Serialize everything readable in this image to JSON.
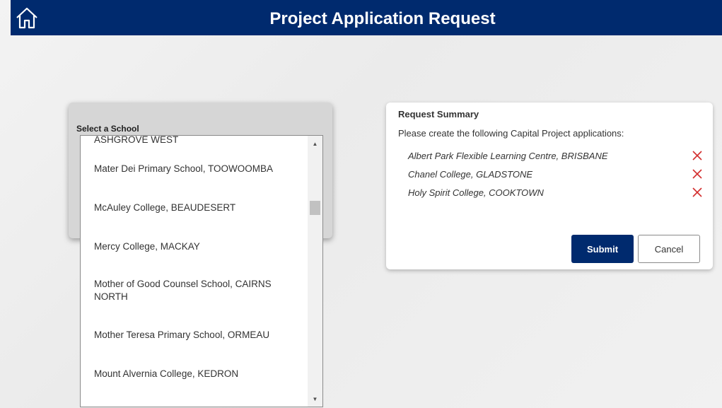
{
  "header": {
    "title": "Project Application Request",
    "home_icon": "home-icon"
  },
  "school_select": {
    "label": "Select a School",
    "options": [
      "ASHGROVE WEST",
      "Mater Dei Primary School, TOOWOOMBA",
      "McAuley College, BEAUDESERT",
      "Mercy College, MACKAY",
      "Mother of Good Counsel School, CAIRNS NORTH",
      "Mother Teresa Primary School, ORMEAU",
      "Mount Alvernia College, KEDRON"
    ],
    "scroll_up_icon": "triangle-up-icon",
    "scroll_down_icon": "triangle-down-icon"
  },
  "summary": {
    "title": "Request Summary",
    "description": "Please create the following Capital Project applications:",
    "items": [
      {
        "label": "Albert Park Flexible Learning Centre, BRISBANE",
        "remove_icon": "close-icon"
      },
      {
        "label": "Chanel College, GLADSTONE",
        "remove_icon": "close-icon"
      },
      {
        "label": "Holy Spirit College, COOKTOWN",
        "remove_icon": "close-icon"
      }
    ],
    "submit_label": "Submit",
    "cancel_label": "Cancel"
  },
  "colors": {
    "brand_navy": "#002a6e",
    "remove_red": "#d32f2f",
    "panel_gray": "#d6d6d6"
  }
}
